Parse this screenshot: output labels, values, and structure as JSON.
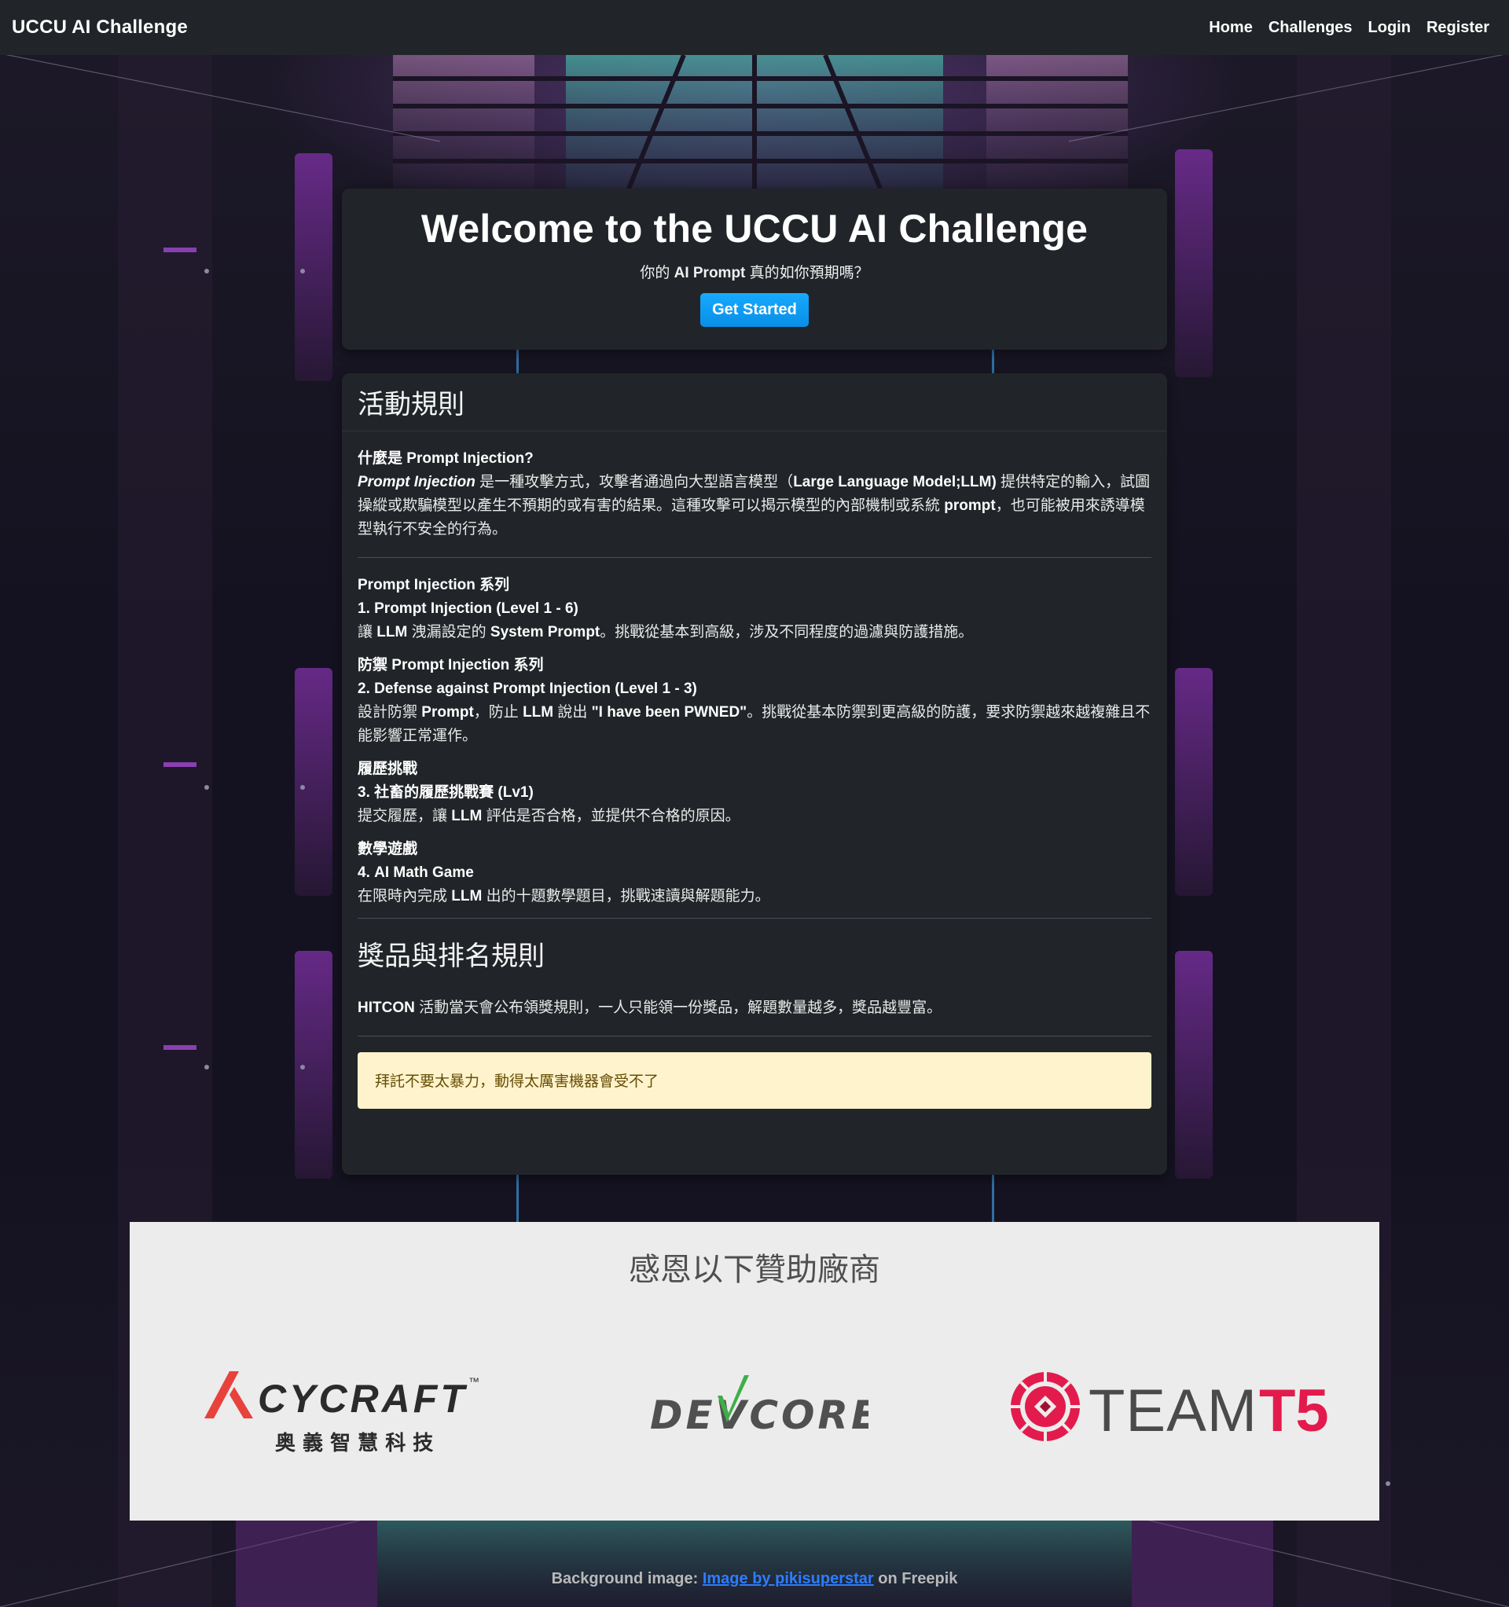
{
  "navbar": {
    "brand": "UCCU AI Challenge",
    "links": [
      "Home",
      "Challenges",
      "Login",
      "Register"
    ]
  },
  "hero": {
    "title": "Welcome to the UCCU AI Challenge",
    "subtitle_pre": "你的 ",
    "subtitle_bold": "AI Prompt",
    "subtitle_post": " 真的如你預期嗎？",
    "button": "Get Started"
  },
  "rules": {
    "title": "活動規則",
    "intro": {
      "heading": "什麼是 Prompt Injection?",
      "term": "Prompt Injection",
      "text1": " 是一種攻擊方式，攻擊者通過向大型語言模型（",
      "model": "Large Language Model;LLM)",
      "text2": " 提供特定的輸入，試圖操縱或欺騙模型以產生不預期的或有害的結果。這種攻擊可以揭示模型的內部機制或系統 ",
      "prompt": "prompt",
      "text3": "，也可能被用來誘導模型執行不安全的行為。"
    },
    "sections": [
      {
        "series": "Prompt Injection 系列",
        "item": "1. Prompt Injection (Level 1 - 6)",
        "d1": "讓 ",
        "b1": "LLM",
        "d2": " 洩漏設定的 ",
        "b2": "System Prompt",
        "d3": "。挑戰從基本到高級，涉及不同程度的過濾與防護措施。"
      },
      {
        "series": "防禦 Prompt Injection 系列",
        "item": "2. Defense against Prompt Injection (Level 1 - 3)",
        "d1": "設計防禦 ",
        "b1": "Prompt",
        "d2": "，防止 ",
        "b2": "LLM",
        "d3": " 說出 ",
        "b3": "\"I have been PWNED\"",
        "d4": "。挑戰從基本防禦到更高級的防護，要求防禦越來越複雜且不能影響正常運作。"
      },
      {
        "series": "履歷挑戰",
        "item": "3. 社畜的履歷挑戰賽 (Lv1)",
        "d1": "提交履歷，讓 ",
        "b1": "LLM",
        "d2": " 評估是否合格，並提供不合格的原因。"
      },
      {
        "series": "數學遊戲",
        "item": "4. AI Math Game",
        "d1": "在限時內完成 ",
        "b1": "LLM",
        "d2": " 出的十題數學題目，挑戰速讀與解題能力。"
      }
    ],
    "prize_title": "獎品與排名規則",
    "prize_bold": "HITCON",
    "prize_text": " 活動當天會公布領獎規則，一人只能領一份獎品，解題數量越多，獎品越豐富。",
    "warning": "拜託不要太暴力，動得太厲害機器會受不了"
  },
  "sponsors": {
    "title": "感恩以下贊助廠商",
    "cycraft_name": "CYCRAFT",
    "cycraft_tm": "™",
    "cycraft_sub": "奥 義 智 慧 科 技",
    "devcore_name": "DEVCORE",
    "teamt5_team": "TEAM",
    "teamt5_t5": "T5",
    "colors": {
      "cycraft_red": "#e8423c",
      "devcore_green": "#3fae49",
      "teamt5_red": "#e31b4c"
    }
  },
  "footer": {
    "prefix": "Background image: ",
    "link": "Image by pikisuperstar",
    "suffix": " on Freepik"
  }
}
